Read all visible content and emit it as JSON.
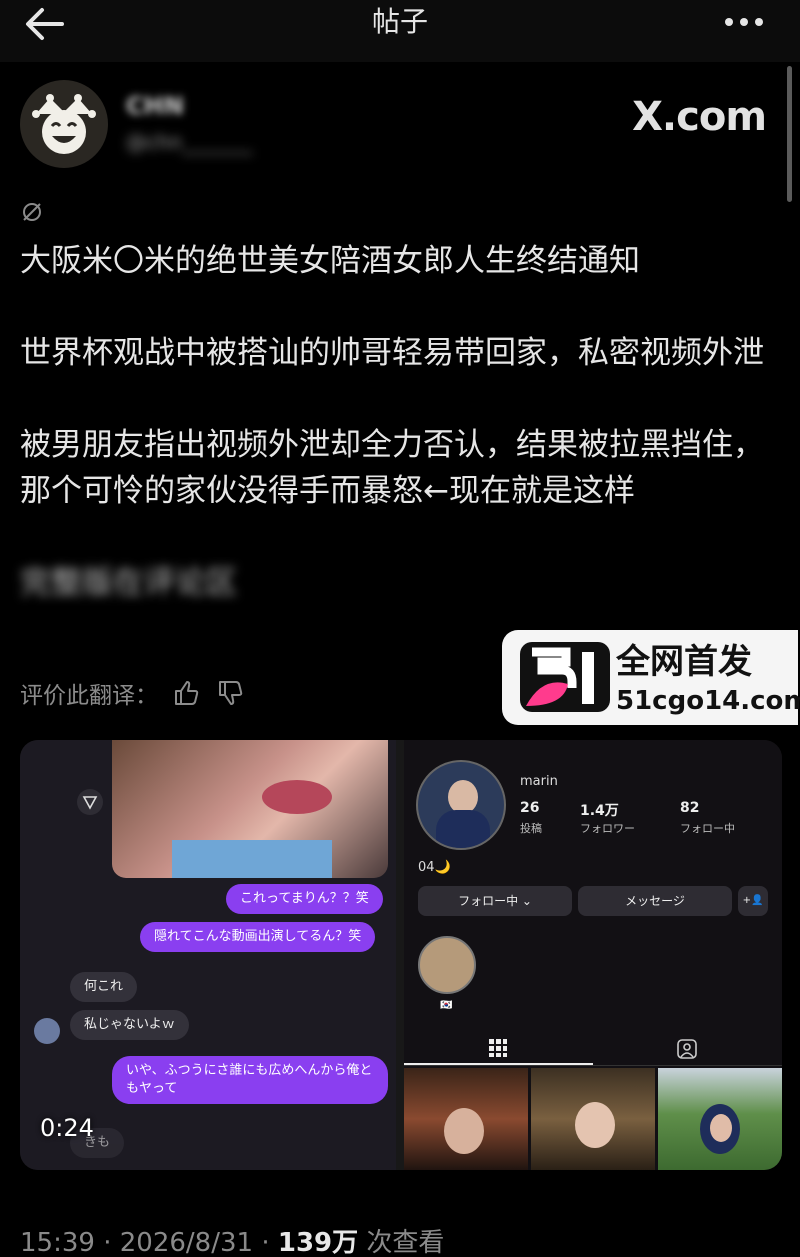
{
  "header": {
    "title": "帖子"
  },
  "author": {
    "name": "CHN",
    "handle": "@chn_______"
  },
  "source": "X.com",
  "post": {
    "paragraphs": [
      "大阪米〇米的绝世美女陪酒女郎人生终结通知",
      "世界杯观战中被搭讪的帅哥轻易带回家，私密视频外泄",
      "被男朋友指出视频外泄却全力否认，结果被拉黑挡住，那个可怜的家伙没得手而暴怒←现在就是这样",
      "完整版在评论区"
    ]
  },
  "rate": {
    "label": "评价此翻译："
  },
  "watermark": {
    "line1": "全网首发",
    "line2": "51cgo14.com",
    "logo_text": "51"
  },
  "media": {
    "duration": "0:24",
    "chat": {
      "me": [
        "これってまりん？？笑",
        "隠れてこんな動画出演してるん？笑",
        "いや、ふつうにさ誰にも広めへんから俺ともヤって"
      ],
      "them": [
        "何これ",
        "私じゃないよｗ",
        "きも"
      ]
    },
    "profile": {
      "name": "marin",
      "stats": [
        {
          "value": "26",
          "label": "投稿"
        },
        {
          "value": "1.4万",
          "label": "フォロワー"
        },
        {
          "value": "82",
          "label": "フォロー中"
        }
      ],
      "bio": "04🌙",
      "buttons": [
        "フォロー中 ⌄",
        "メッセージ",
        "+👤"
      ],
      "highlight_label": "🇰🇷"
    }
  },
  "footer": {
    "time": "15:39",
    "date": "2026/8/31",
    "views": "139万",
    "views_suffix": "次查看"
  },
  "colors": {
    "background": "#000000",
    "bubble_me": "#8a3ff0",
    "bubble_them": "#33313a",
    "text": "#e6e6e6"
  }
}
